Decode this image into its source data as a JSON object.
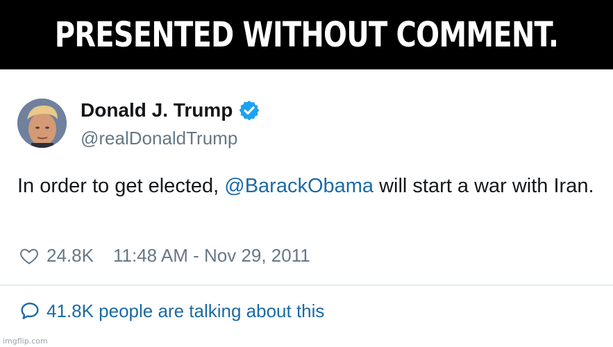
{
  "banner": {
    "text": "PRESENTED WITHOUT COMMENT."
  },
  "tweet": {
    "display_name": "Donald J. Trump",
    "handle": "@realDonaldTrump",
    "text_before": "In order to get elected, ",
    "mention": "@BarackObama",
    "text_after": " will start a war with Iran.",
    "likes": "24.8K",
    "timestamp": "11:48 AM - Nov 29, 2011",
    "talking": "41.8K people are talking about this"
  },
  "watermark": "imgflip.com",
  "colors": {
    "banner_bg": "#000000",
    "link": "#1b6aa5",
    "verified": "#1da1f2",
    "secondary_text": "#657786"
  },
  "icons": {
    "verified": "verified-badge-icon",
    "like": "heart-icon",
    "reply": "speech-bubble-icon"
  }
}
